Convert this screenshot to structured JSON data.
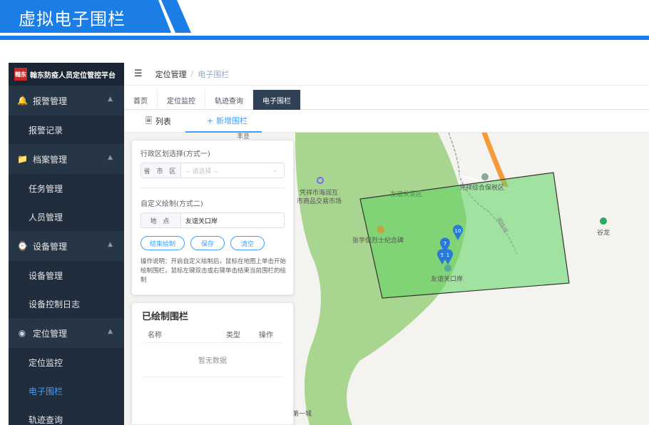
{
  "banner": {
    "title": "虚拟电子围栏"
  },
  "app": {
    "name": "翰东防疫人员定位管控平台",
    "logo_text": "翰东"
  },
  "sidebar": {
    "groups": [
      {
        "label": "报警管理",
        "icon": "bell-icon",
        "items": [
          {
            "label": "报警记录"
          }
        ]
      },
      {
        "label": "档案管理",
        "icon": "folder-icon",
        "items": [
          {
            "label": "任务管理"
          },
          {
            "label": "人员管理"
          }
        ]
      },
      {
        "label": "设备管理",
        "icon": "watch-icon",
        "items": [
          {
            "label": "设备管理"
          },
          {
            "label": "设备控制日志"
          }
        ]
      },
      {
        "label": "定位管理",
        "icon": "location-icon",
        "items": [
          {
            "label": "定位监控"
          },
          {
            "label": "电子围栏"
          },
          {
            "label": "轨迹查询"
          }
        ]
      }
    ]
  },
  "breadcrumb": {
    "parent": "定位管理",
    "separator": "/",
    "current": "电子围栏"
  },
  "tabs": [
    {
      "label": "首页"
    },
    {
      "label": "定位监控"
    },
    {
      "label": "轨迹查询"
    },
    {
      "label": "电子围栏"
    }
  ],
  "subtabs": {
    "list": "列表",
    "add": "新增围栏"
  },
  "form": {
    "region_title": "行政区划选择(方式一)",
    "region_prefix": "省 市 区",
    "region_placeholder": "-- 请选择 --",
    "custom_title": "自定义绘制(方式二)",
    "place_prefix": "地 点",
    "place_value": "友谊关口岸",
    "btn_finish": "结束绘制",
    "btn_save": "保存",
    "btn_clear": "清空",
    "help": "操作说明：开启自定义绘制后，鼠标在地图上单击开始绘制围栏，鼠标左键双击或右键单击结束当前围栏的绘制"
  },
  "drawn": {
    "title": "已绘制围栏",
    "col_name": "名称",
    "col_type": "类型",
    "col_action": "操作",
    "empty": "暂无数据"
  },
  "map": {
    "labels": {
      "fengdan": "丰旦",
      "market1": "凭祥市海润互",
      "market2": "市商品交易市场",
      "scenic": "友谊关景区",
      "zone": "凭祥综合保税区",
      "memorial": "张学保烈士纪念碑",
      "port": "友谊关口岸",
      "gulong": "谷龙",
      "diyicheng": "第一城",
      "rail": "湘桂线"
    },
    "markers": [
      "10",
      "7",
      "5",
      "1"
    ],
    "colors": {
      "fence": "#5fd35f",
      "forest": "#a8d690",
      "road": "#f39b3c"
    }
  }
}
